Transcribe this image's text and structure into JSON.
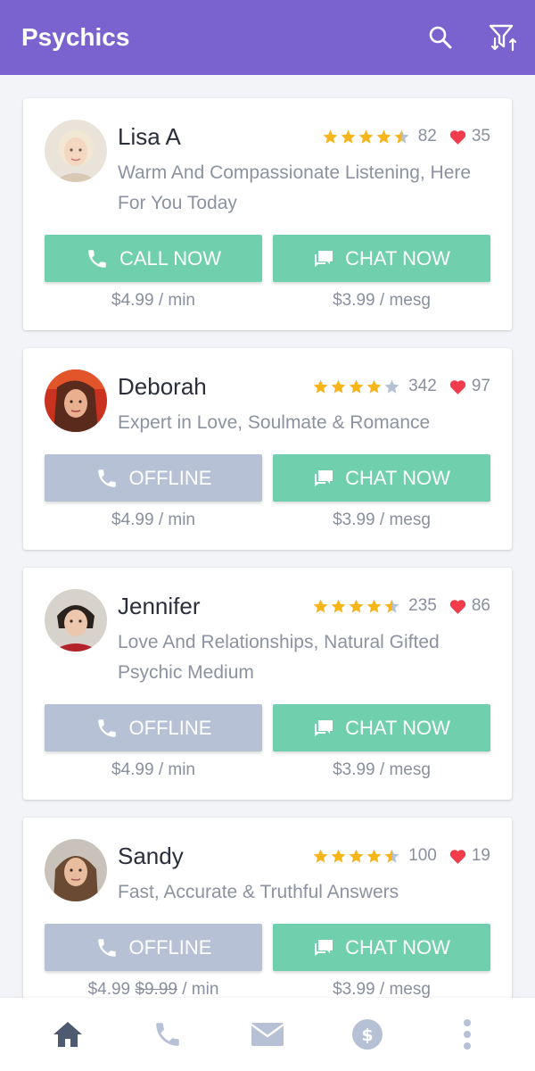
{
  "app": {
    "title": "Psychics"
  },
  "colors": {
    "header": "#7a63cf",
    "green": "#70cfad",
    "offline": "#b7c1d6",
    "star": "#f5b51b",
    "heart": "#f03c4b"
  },
  "cards": [
    {
      "name": "Lisa A",
      "reviews": "82",
      "likes": "35",
      "rating": 4.5,
      "description": "Warm And Compassionate Listening, Here For You Today",
      "call_label": "CALL NOW",
      "call_status": "online",
      "chat_label": "CHAT NOW",
      "call_price": "$4.99 / min",
      "chat_price": "$3.99 / mesg"
    },
    {
      "name": "Deborah",
      "reviews": "342",
      "likes": "97",
      "rating": 4,
      "description": "Expert in Love, Soulmate & Romance",
      "call_label": "OFFLINE",
      "call_status": "offline",
      "chat_label": "CHAT NOW",
      "call_price": "$4.99 / min",
      "chat_price": "$3.99 / mesg"
    },
    {
      "name": "Jennifer",
      "reviews": "235",
      "likes": "86",
      "rating": 4.5,
      "description": "Love And Relationships, Natural Gifted Psychic Medium",
      "call_label": "OFFLINE",
      "call_status": "offline",
      "chat_label": "CHAT NOW",
      "call_price": "$4.99 / min",
      "chat_price": "$3.99 / mesg"
    },
    {
      "name": "Sandy",
      "reviews": "100",
      "likes": "19",
      "rating": 4.5,
      "description": "Fast, Accurate & Truthful Answers",
      "call_label": "OFFLINE",
      "call_status": "offline",
      "chat_label": "CHAT NOW",
      "call_price_new": "$4.99",
      "call_price_old": "$9.99",
      "call_price_unit": "/ min",
      "chat_price": "$3.99 / mesg"
    }
  ],
  "bottom_nav": [
    "home-icon",
    "phone-icon",
    "mail-icon",
    "dollar-icon",
    "more-icon"
  ]
}
